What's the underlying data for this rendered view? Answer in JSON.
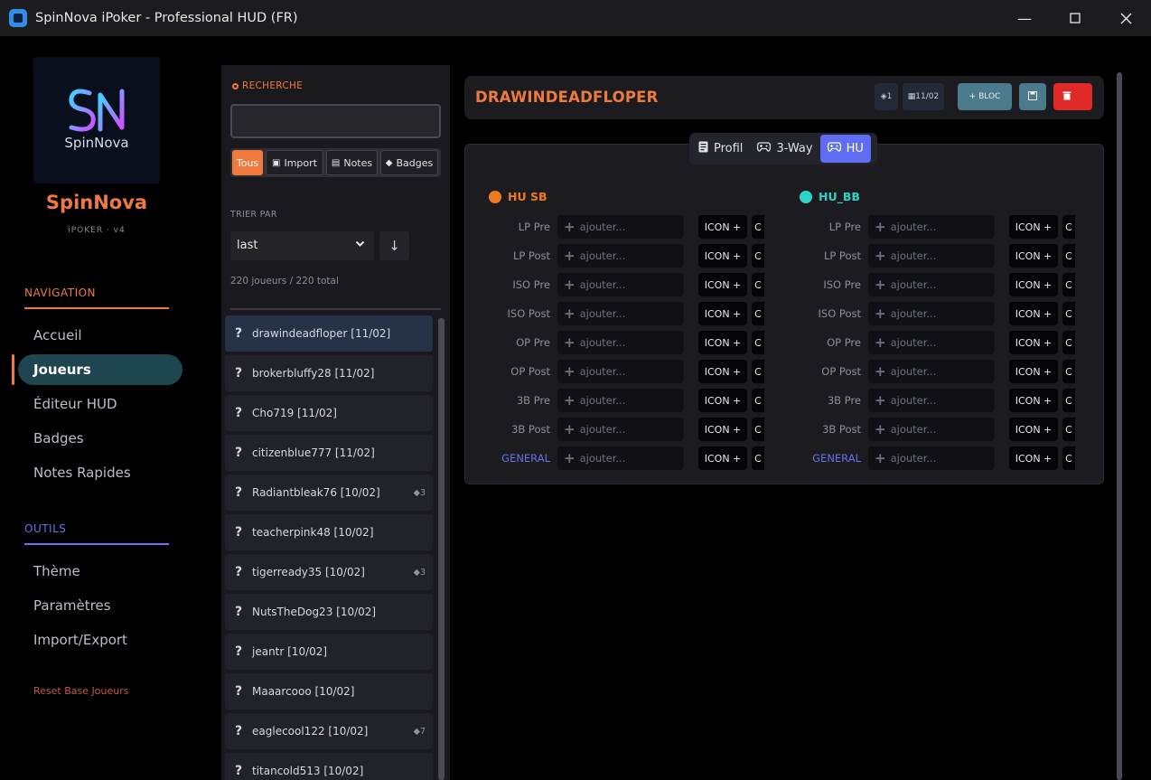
{
  "window": {
    "title": "SpinNova iPoker - Professional HUD (FR)"
  },
  "sidebar": {
    "brand_name": "SpinNova",
    "brand_sub": "iPOKER · v4",
    "logo_text": "SpinNova",
    "nav_title": "NAVIGATION",
    "nav": [
      {
        "label": "Accueil"
      },
      {
        "label": "Joueurs"
      },
      {
        "label": "Éditeur HUD"
      },
      {
        "label": "Badges"
      },
      {
        "label": "Notes Rapides"
      }
    ],
    "tools_title": "OUTILS",
    "tools": [
      {
        "label": "Thème"
      },
      {
        "label": "Paramètres"
      },
      {
        "label": "Import/Export"
      }
    ],
    "reset_label": "Reset Base Joueurs"
  },
  "players": {
    "search_label": "RECHERCHE",
    "search_value": "",
    "filters": [
      "Tous",
      "Import",
      "Notes",
      "Badges"
    ],
    "sort_label": "TRIER PAR",
    "sort_value": "last",
    "count_text": "220 joueurs / 220 total",
    "list": [
      {
        "name": "drawindeadfloper [11/02]",
        "badge": ""
      },
      {
        "name": "brokerbluffy28 [11/02]",
        "badge": ""
      },
      {
        "name": "Cho719 [11/02]",
        "badge": ""
      },
      {
        "name": "citizenblue777 [11/02]",
        "badge": ""
      },
      {
        "name": "Radiantbleak76 [10/02]",
        "badge": "3"
      },
      {
        "name": "teacherpink48 [10/02]",
        "badge": ""
      },
      {
        "name": "tigerready35 [10/02]",
        "badge": "3"
      },
      {
        "name": "NutsTheDog23 [10/02]",
        "badge": ""
      },
      {
        "name": "jeantr [10/02]",
        "badge": ""
      },
      {
        "name": "Maaarcooo [10/02]",
        "badge": ""
      },
      {
        "name": "eaglecool122 [10/02]",
        "badge": "7"
      },
      {
        "name": "titancold513 [10/02]",
        "badge": ""
      }
    ]
  },
  "header": {
    "player_name": "DRAWINDEADFLOPER",
    "count_badge": "1",
    "date_badge": "11/02",
    "add_block": "+ BLOC"
  },
  "tabs": [
    {
      "label": "Profil"
    },
    {
      "label": "3-Way"
    },
    {
      "label": "HU"
    }
  ],
  "hud": {
    "input_placeholder": "ajouter...",
    "icon_button": "ICON +",
    "extra_button": "C",
    "stat_labels": [
      "LP Pre",
      "LP Post",
      "ISO Pre",
      "ISO Post",
      "OP Pre",
      "OP Post",
      "3B Pre",
      "3B Post",
      "GENERAL"
    ],
    "columns": [
      {
        "title": "HU SB",
        "color": "#f07a1e"
      },
      {
        "title": "HU_BB",
        "color": "#2ed3c8"
      }
    ]
  },
  "colors": {
    "accent": "#f07a3e",
    "tab_active": "#5f6df2",
    "nav_active": "#1f4650"
  }
}
